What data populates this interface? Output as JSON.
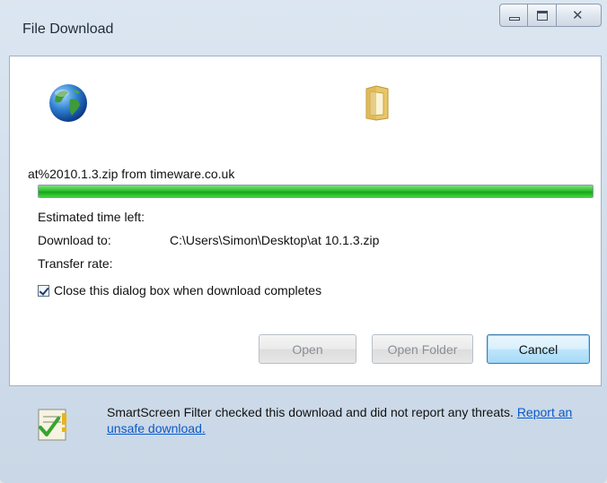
{
  "window": {
    "title": "File Download"
  },
  "titlebar_buttons": {
    "close_glyph": "✕"
  },
  "download": {
    "file_label": "at%2010.1.3.zip from timeware.co.uk",
    "progress_percent": 100,
    "estimated_time_label": "Estimated time left:",
    "download_to_label": "Download to:",
    "download_to_value": "C:\\Users\\Simon\\Desktop\\at 10.1.3.zip",
    "transfer_rate_label": "Transfer rate:"
  },
  "options": {
    "close_when_done_label": "Close this dialog box when download completes",
    "close_when_done_checked": true
  },
  "buttons": {
    "open": "Open",
    "open_folder": "Open Folder",
    "cancel": "Cancel"
  },
  "footer": {
    "message": "SmartScreen Filter checked this download and did not report any threats.",
    "link": "Report an unsafe download."
  },
  "colors": {
    "progress": "#2fc02f",
    "link": "#0b59c7",
    "default_button_border": "#3c7fb1"
  },
  "icons": [
    "globe-icon",
    "folder-icon",
    "shield-check-icon",
    "minimize-icon",
    "maximize-icon",
    "close-icon"
  ]
}
